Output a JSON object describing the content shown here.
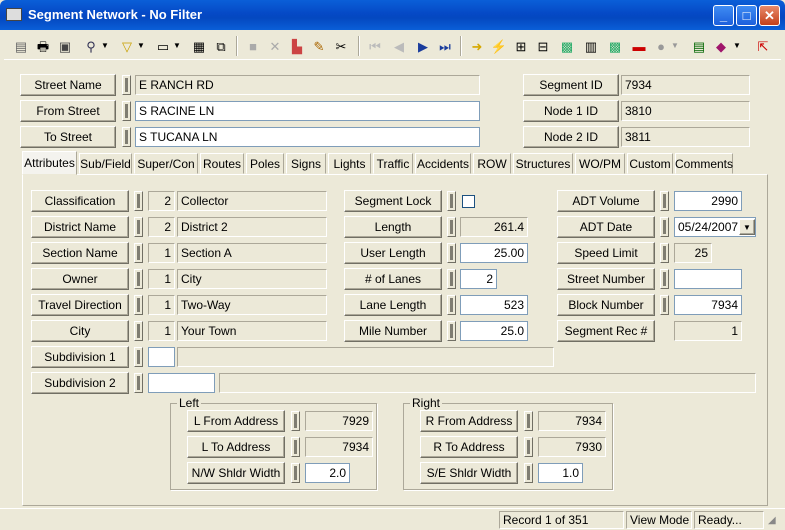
{
  "window": {
    "title": "Segment Network - No Filter"
  },
  "header": {
    "street_name": {
      "label": "Street Name",
      "value": "E RANCH RD"
    },
    "from_street": {
      "label": "From Street",
      "value": "S RACINE LN"
    },
    "to_street": {
      "label": "To Street",
      "value": "S TUCANA LN"
    },
    "segment_id": {
      "label": "Segment ID",
      "value": "7934"
    },
    "node1_id": {
      "label": "Node 1 ID",
      "value": "3810"
    },
    "node2_id": {
      "label": "Node 2 ID",
      "value": "3811"
    }
  },
  "tabs": [
    "Attributes",
    "Sub/Field",
    "Super/Con",
    "Routes",
    "Poles",
    "Signs",
    "Lights",
    "Traffic",
    "Accidents",
    "ROW",
    "Structures",
    "WO/PM",
    "Custom",
    "Comments"
  ],
  "attributes": {
    "classification": {
      "label": "Classification",
      "code": "2",
      "value": "Collector"
    },
    "district_name": {
      "label": "District Name",
      "code": "2",
      "value": "District 2"
    },
    "section_name": {
      "label": "Section Name",
      "code": "1",
      "value": "Section A"
    },
    "owner": {
      "label": "Owner",
      "code": "1",
      "value": "City"
    },
    "travel_direction": {
      "label": "Travel Direction",
      "code": "1",
      "value": "Two-Way"
    },
    "city": {
      "label": "City",
      "code": "1",
      "value": "Your Town"
    },
    "subdivision1": {
      "label": "Subdivision 1",
      "code": "",
      "value": ""
    },
    "subdivision2": {
      "label": "Subdivision 2",
      "code": "",
      "value": ""
    },
    "segment_lock": {
      "label": "Segment Lock",
      "checked": false
    },
    "length": {
      "label": "Length",
      "value": "261.4"
    },
    "user_length": {
      "label": "User Length",
      "value": "25.00"
    },
    "num_lanes": {
      "label": "# of Lanes",
      "value": "2"
    },
    "lane_length": {
      "label": "Lane Length",
      "value": "523"
    },
    "mile_number": {
      "label": "Mile Number",
      "value": "25.0"
    },
    "adt_volume": {
      "label": "ADT Volume",
      "value": "2990"
    },
    "adt_date": {
      "label": "ADT Date",
      "value": "05/24/2007"
    },
    "speed_limit": {
      "label": "Speed Limit",
      "value": "25"
    },
    "street_number": {
      "label": "Street Number",
      "value": ""
    },
    "block_number": {
      "label": "Block Number",
      "value": "7934"
    },
    "segment_rec": {
      "label": "Segment Rec #",
      "value": "1"
    },
    "left": {
      "title": "Left",
      "from_address": {
        "label": "L From Address",
        "value": "7929"
      },
      "to_address": {
        "label": "L To Address",
        "value": "7934"
      },
      "shldr_width": {
        "label": "N/W Shldr Width",
        "value": "2.0"
      }
    },
    "right": {
      "title": "Right",
      "from_address": {
        "label": "R From Address",
        "value": "7934"
      },
      "to_address": {
        "label": "R To Address",
        "value": "7930"
      },
      "shldr_width": {
        "label": "S/E Shldr Width",
        "value": "1.0"
      }
    }
  },
  "status": {
    "record": "Record 1 of 351",
    "mode": "View Mode",
    "state": "Ready..."
  }
}
